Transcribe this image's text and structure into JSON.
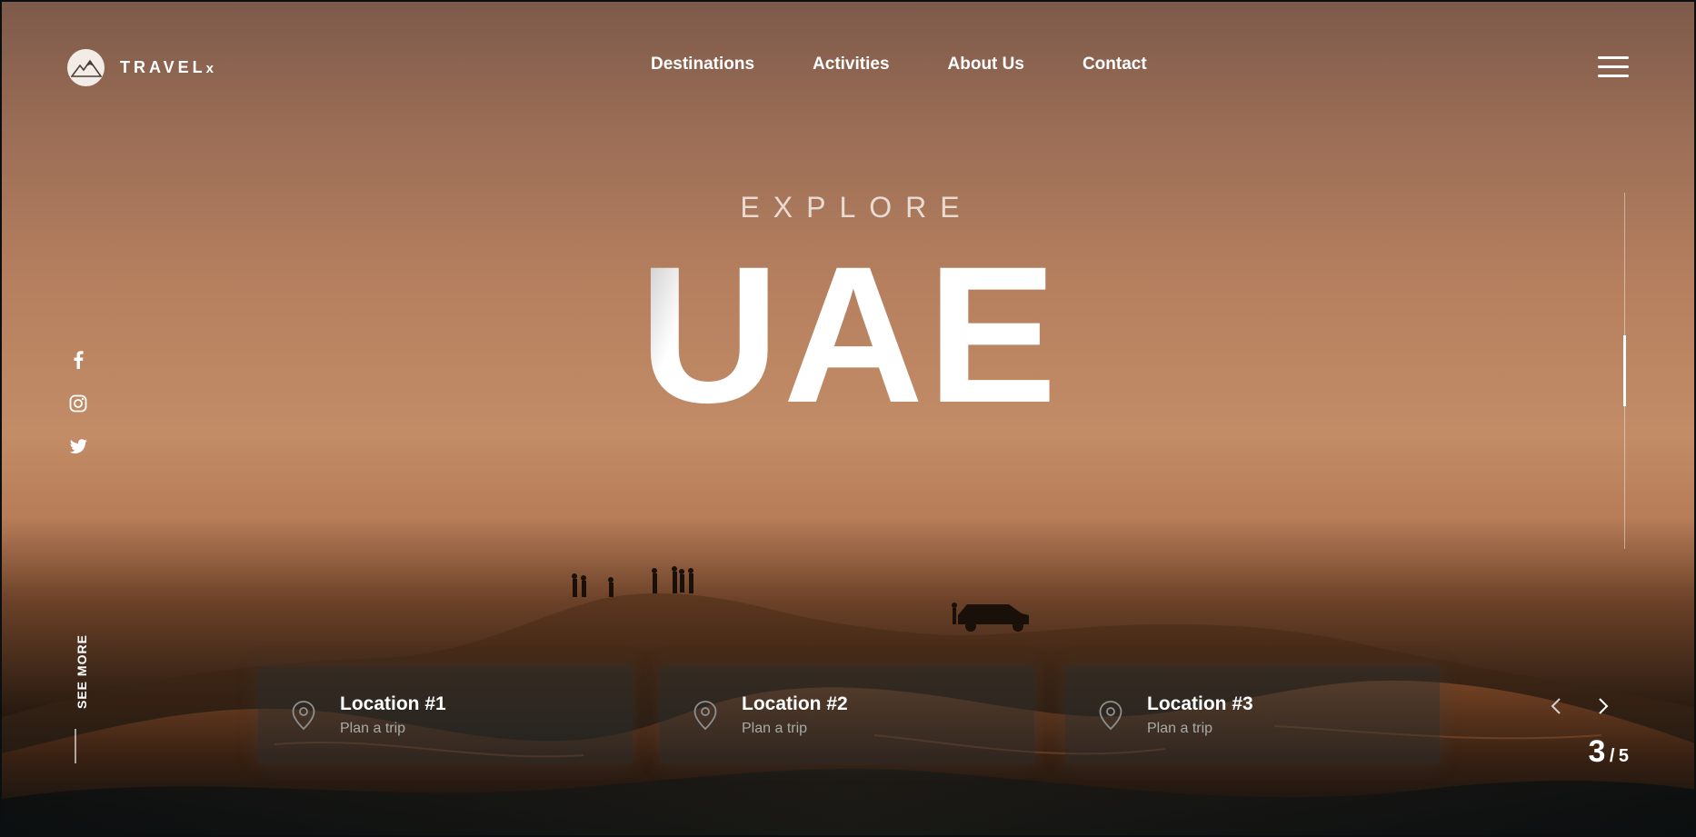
{
  "brand": {
    "name": "TRAVEL",
    "suffix": "x"
  },
  "nav": {
    "items": [
      "Destinations",
      "Activities",
      "About Us",
      "Contact"
    ]
  },
  "hero": {
    "eyebrow": "EXPLORE",
    "title": "UAE"
  },
  "social": {
    "icons": [
      "facebook-icon",
      "instagram-icon",
      "twitter-icon"
    ]
  },
  "see_more": {
    "label": "SEE MORE"
  },
  "progress": {
    "current_fraction": 0.2
  },
  "cards": [
    {
      "title": "Location #1",
      "subtitle": "Plan a trip"
    },
    {
      "title": "Location #2",
      "subtitle": "Plan a trip"
    },
    {
      "title": "Location #3",
      "subtitle": "Plan a trip"
    }
  ],
  "slider": {
    "current": "3",
    "total": "5",
    "separator": "/"
  },
  "colors": {
    "accent": "#ffffff",
    "sky": "#c28c67",
    "sand_dark": "#24180f"
  }
}
